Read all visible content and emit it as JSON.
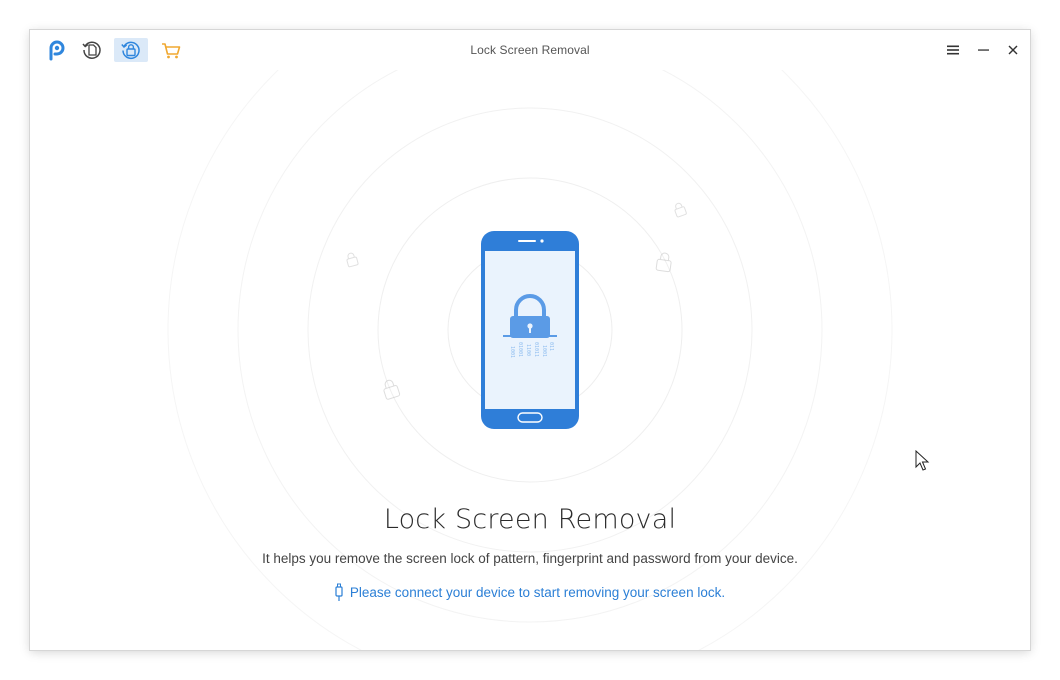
{
  "window": {
    "title": "Lock Screen Removal"
  },
  "toolbar": {
    "items": [
      {
        "icon": "app-logo-icon",
        "active": false
      },
      {
        "icon": "restore-history-icon",
        "active": false
      },
      {
        "icon": "lock-screen-removal-icon",
        "active": true
      },
      {
        "icon": "shopping-cart-icon",
        "active": false
      }
    ]
  },
  "controls": {
    "menu_icon": "hamburger-menu-icon",
    "minimize_icon": "minimize-icon",
    "close_icon": "close-icon"
  },
  "main": {
    "heading": "Lock Screen Removal",
    "description": "It helps you remove the screen lock of pattern, fingerprint and password from your device.",
    "connect_prompt": "Please connect your device to start removing your screen lock.",
    "connect_icon": "usb-cable-icon",
    "illustration_icon": "phone-lock-icon"
  },
  "colors": {
    "accent": "#2b7fd6",
    "phone_body": "#2f7ed8",
    "phone_screen": "#eaf3fd",
    "cart": "#f0a830",
    "active_tab_bg": "#dbe9f8"
  }
}
